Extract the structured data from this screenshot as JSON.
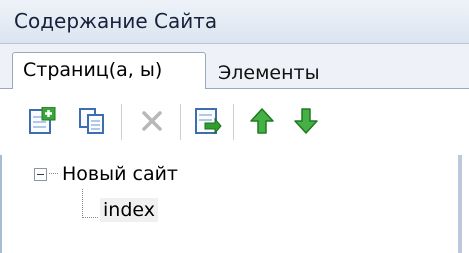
{
  "panel": {
    "title": "Содержание Сайта"
  },
  "tabs": [
    {
      "label": "Страниц(а, ы)",
      "active": true
    },
    {
      "label": "Элементы",
      "active": false
    }
  ],
  "toolbar": {
    "buttons": [
      {
        "name": "add-page",
        "icon": "new-page-icon"
      },
      {
        "name": "copy-page",
        "icon": "copy-pages-icon"
      },
      {
        "name": "delete-page",
        "icon": "delete-x-icon",
        "disabled": true
      },
      {
        "name": "import-page",
        "icon": "import-page-icon"
      },
      {
        "name": "move-up",
        "icon": "arrow-up-icon"
      },
      {
        "name": "move-down",
        "icon": "arrow-down-icon"
      }
    ]
  },
  "tree": {
    "root": {
      "label": "Новый сайт",
      "expanded": true,
      "children": [
        {
          "label": "index"
        }
      ]
    }
  },
  "colors": {
    "titlebar": "#dbe4f0",
    "tab_border": "#9aa8bd",
    "green_arrow": "#2f9e2f",
    "icon_blue": "#3d7fd0"
  }
}
